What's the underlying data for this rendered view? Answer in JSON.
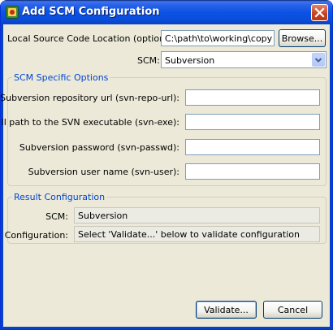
{
  "window": {
    "title": "Add SCM Configuration",
    "icons": {
      "app": "app-icon",
      "close": "close-icon"
    }
  },
  "source": {
    "label": "Local Source Code Location (optional):",
    "value": "C:\\path\\to\\working\\copy",
    "browse_label": "Browse..."
  },
  "scm": {
    "label": "SCM:",
    "selected": "Subversion",
    "dropdown_icon": "chevron-down-icon"
  },
  "options_group": {
    "title": "SCM Specific Options",
    "fields": [
      {
        "label": "Subversion repository url (svn-repo-url):",
        "value": ""
      },
      {
        "label": "Full path to the SVN executable (svn-exe):",
        "value": ""
      },
      {
        "label": "Subversion password (svn-passwd):",
        "value": ""
      },
      {
        "label": "Subversion user name (svn-user):",
        "value": ""
      }
    ]
  },
  "result_group": {
    "title": "Result Configuration",
    "scm_label": "SCM:",
    "scm_value": "Subversion",
    "config_label": "Configuration:",
    "config_value": "Select 'Validate...' below to validate configuration"
  },
  "footer": {
    "validate_label": "Validate...",
    "cancel_label": "Cancel"
  },
  "colors": {
    "titlebar": "#0b53e5",
    "dialog_bg": "#ece9d8",
    "group_title": "#0046d5",
    "close_button": "#c3421a"
  }
}
